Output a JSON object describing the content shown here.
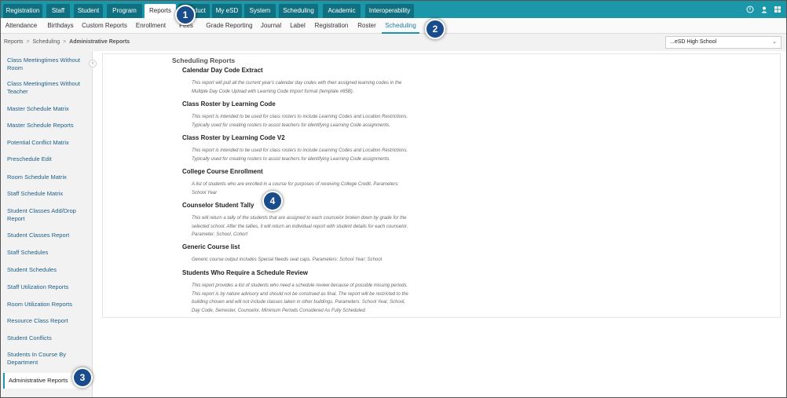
{
  "top_nav": {
    "tabs": [
      "Registration",
      "Staff",
      "Student",
      "Program",
      "Reports",
      "Conduct",
      "My eSD",
      "System",
      "Scheduling",
      "Academic",
      "Interoperability"
    ],
    "active": "Reports",
    "icons": [
      "help-icon",
      "user-icon",
      "apps-icon"
    ]
  },
  "sub_nav": {
    "tabs": [
      "Attendance",
      "Birthdays",
      "Custom Reports",
      "Enrollment",
      "Fees",
      "Grade Reporting",
      "Journal",
      "Label",
      "Registration",
      "Roster",
      "Scheduling"
    ],
    "active": "Scheduling"
  },
  "breadcrumb": {
    "items": [
      "Reports",
      "Scheduling"
    ],
    "current": "Administrative Reports",
    "separator": ">"
  },
  "school_select": {
    "value": "...eSD High School",
    "chevron": "⌄"
  },
  "sidebar": {
    "collapse_glyph": "‹",
    "items": [
      "Class Meetingtimes Without Room",
      "Class Meetingtimes Without Teacher",
      "Master Schedule Matrix",
      "Master Schedule Reports",
      "Potential Conflict Matrix",
      "Preschedule Edit",
      "Room Schedule Matrix",
      "Staff Schedule Matrix",
      "Student Classes Add/Drop Report",
      "Student Classes Report",
      "Staff Schedules",
      "Student Schedules",
      "Staff Utilization Reports",
      "Room Utilization Reports",
      "Resource Class Report",
      "Student Conflicts",
      "Students In Course By Department",
      "Administrative Reports"
    ],
    "active": "Administrative Reports"
  },
  "main": {
    "section_title": "Scheduling Reports",
    "reports": [
      {
        "title": "Calendar Day Code Extract",
        "desc_lines": [
          "This report will pull all the current year's calendar day codes with their assigned learning codes in the",
          "Multiple Day Code Upload with Learning Code Import format (template #65B)."
        ]
      },
      {
        "title": "Class Roster by Learning Code",
        "desc_lines": [
          "This report is intended to be used for class rosters to include Learning Codes and Location Restrictions.",
          "Typically used for creating rosters to assist teachers for identifying Learning Code assignments."
        ]
      },
      {
        "title": "Class Roster by Learning Code V2",
        "desc_lines": [
          "This report is intended to be used for class rosters to include Learning Codes and Location Restrictions.",
          "Typically used for creating rosters to assist teachers for identifying Learning Code assignments."
        ]
      },
      {
        "title": "College Course Enrollment",
        "desc_lines": [
          "A list of students who are enrolled in a course for purposes of receiving College Credit. Parameters:",
          "School Year"
        ]
      },
      {
        "title": "Counselor Student Tally",
        "desc_lines": [
          "This will return a tally of the students that are assigned to each counselor broken down by grade for the",
          "selected school. After the tallies, it will return an individual report with student details for each counselor.",
          "Parameter: School, Cohort"
        ]
      },
      {
        "title": "Generic Course list",
        "desc_lines": [
          "Generic course output includes Special Needs seat caps. Parameters: School Year; School"
        ]
      },
      {
        "title": "Students Who Require a Schedule Review",
        "desc_lines": [
          "This report provides a list of students who need a schedule review because of possible missing periods.",
          "This report is by nature advisory and should not be construed as final. The report will be restricted to the",
          "building chosen and will not include classes taken in other buildings. Parameters: School Year, School,",
          "Day Code, Semester, Counselor, Minimum Periods Considered As Fully Scheduled."
        ]
      }
    ]
  },
  "callouts": [
    "1",
    "2",
    "3",
    "4"
  ],
  "colors": {
    "nav_bg": "#1c97a9",
    "nav_tab": "#10707f",
    "callout": "#1a4b8a",
    "link": "#1d5f87"
  }
}
